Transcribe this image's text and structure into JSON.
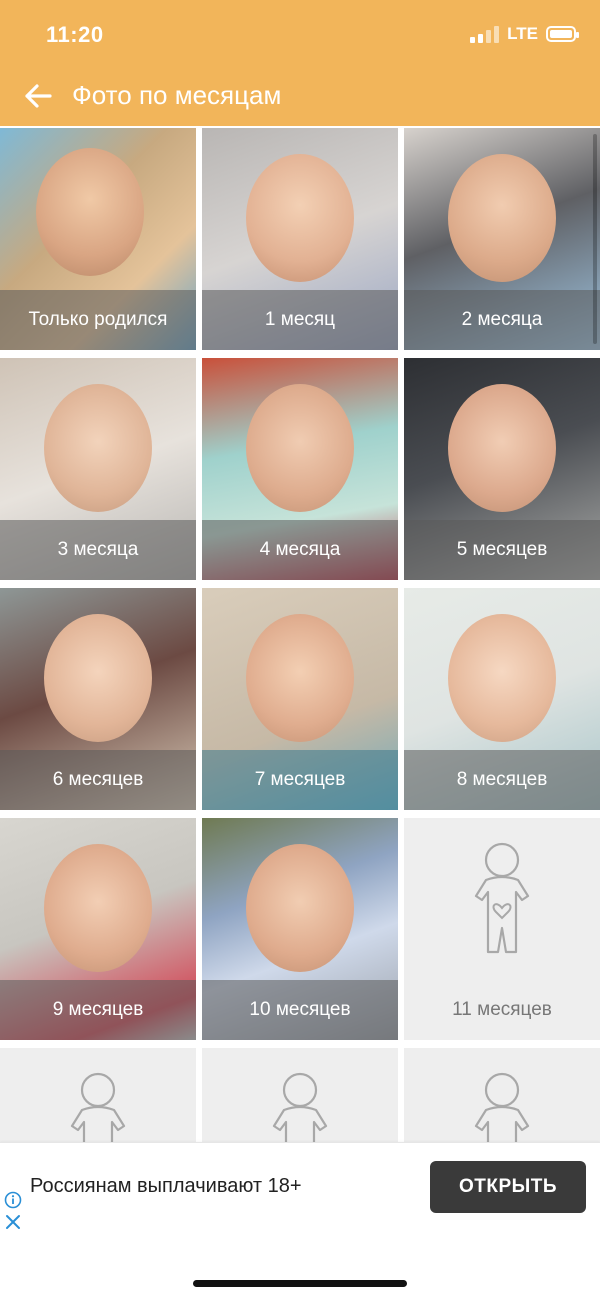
{
  "status_bar": {
    "time": "11:20",
    "network": "LTE"
  },
  "header": {
    "title": "Фото по месяцам",
    "accent_color": "#F2B55A",
    "back_icon": "arrow-left-icon"
  },
  "tiles": [
    {
      "caption": "Только родился",
      "has_photo": true
    },
    {
      "caption": "1 месяц",
      "has_photo": true
    },
    {
      "caption": "2 месяца",
      "has_photo": true
    },
    {
      "caption": "3 месяца",
      "has_photo": true
    },
    {
      "caption": "4 месяца",
      "has_photo": true
    },
    {
      "caption": "5 месяцев",
      "has_photo": true
    },
    {
      "caption": "6 месяцев",
      "has_photo": true
    },
    {
      "caption": "7 месяцев",
      "has_photo": true
    },
    {
      "caption": "8 месяцев",
      "has_photo": true
    },
    {
      "caption": "9 месяцев",
      "has_photo": true
    },
    {
      "caption": "10 месяцев",
      "has_photo": true
    },
    {
      "caption": "11 месяцев",
      "has_photo": false
    },
    {
      "caption": "",
      "has_photo": false
    },
    {
      "caption": "",
      "has_photo": false
    },
    {
      "caption": "",
      "has_photo": false
    }
  ],
  "ad": {
    "text": "Россиянам выплачивают 18+",
    "button": "ОТКРЫТЬ"
  }
}
